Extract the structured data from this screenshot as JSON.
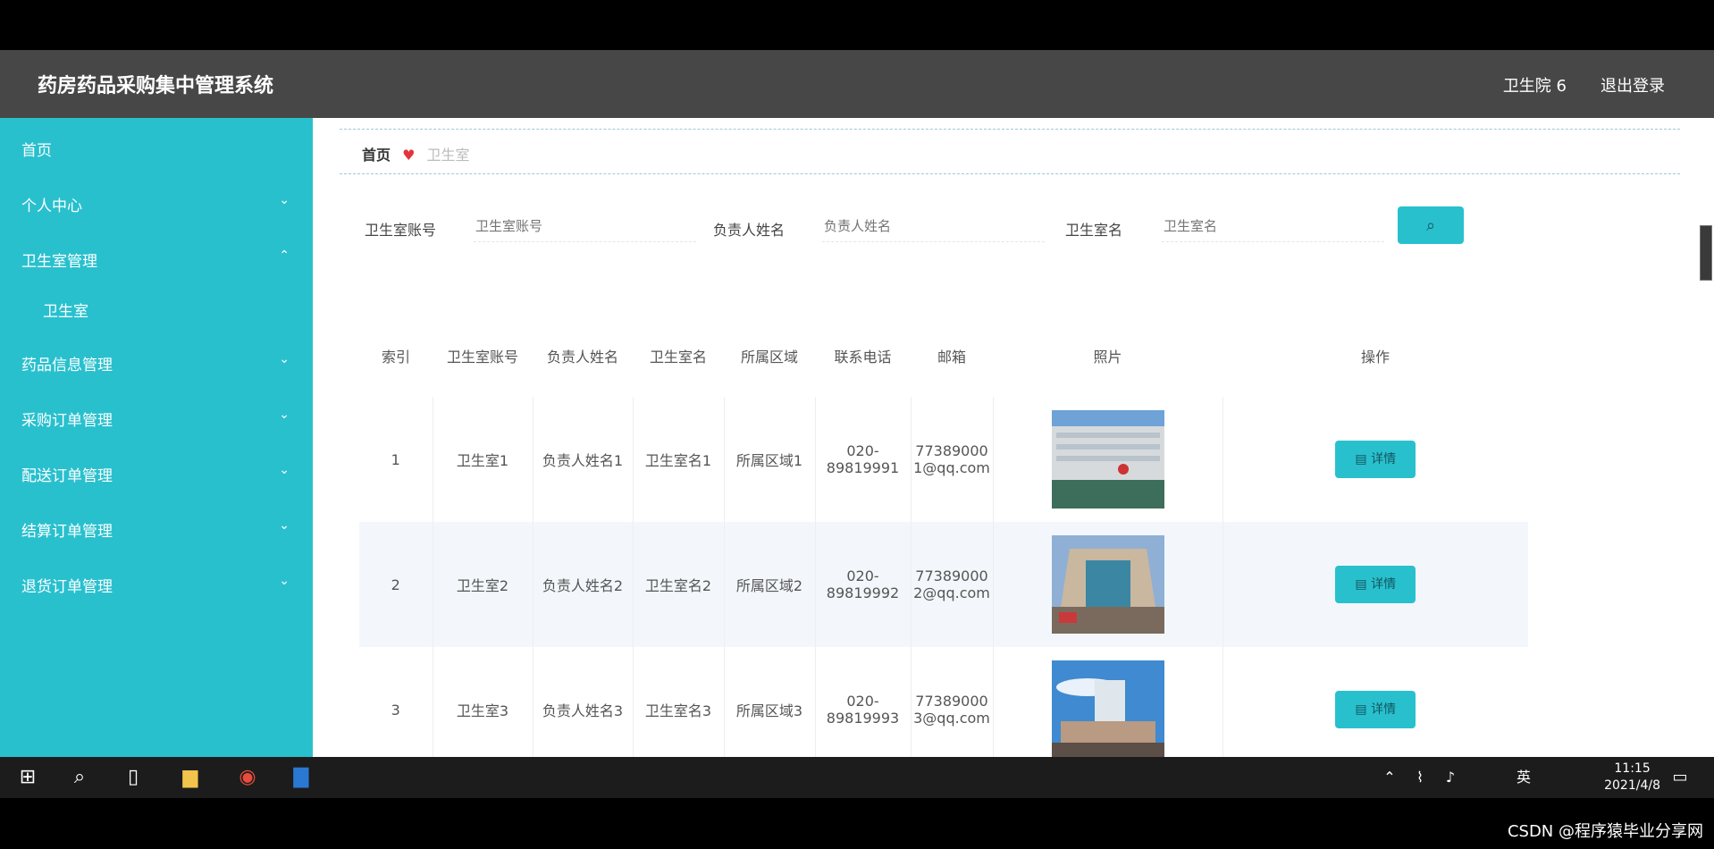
{
  "header": {
    "title": "药房药品采购集中管理系统",
    "user": "卫生院 6",
    "logout": "退出登录"
  },
  "sidebar": {
    "items": [
      {
        "label": "首页",
        "caret": ""
      },
      {
        "label": "个人中心",
        "caret": "⌄"
      },
      {
        "label": "卫生室管理",
        "caret": "⌃"
      },
      {
        "label": "卫生室",
        "caret": ""
      },
      {
        "label": "药品信息管理",
        "caret": "⌄"
      },
      {
        "label": "采购订单管理",
        "caret": "⌄"
      },
      {
        "label": "配送订单管理",
        "caret": "⌄"
      },
      {
        "label": "结算订单管理",
        "caret": "⌄"
      },
      {
        "label": "退货订单管理",
        "caret": "⌄"
      }
    ]
  },
  "breadcrumb": {
    "home": "首页",
    "current": "卫生室"
  },
  "search": {
    "label1": "卫生室账号",
    "ph1": "卫生室账号",
    "label2": "负责人姓名",
    "ph2": "负责人姓名",
    "label3": "卫生室名",
    "ph3": "卫生室名",
    "button_icon": "search-icon"
  },
  "table": {
    "headers": [
      "索引",
      "卫生室账号",
      "负责人姓名",
      "卫生室名",
      "所属区域",
      "联系电话",
      "邮箱",
      "照片",
      "操作"
    ],
    "rows": [
      {
        "idx": "1",
        "account": "卫生室1",
        "person": "负责人姓名1",
        "name": "卫生室名1",
        "area": "所属区域1",
        "phone": "020-89819991",
        "email": "773890001@qq.com",
        "action": "详情"
      },
      {
        "idx": "2",
        "account": "卫生室2",
        "person": "负责人姓名2",
        "name": "卫生室名2",
        "area": "所属区域2",
        "phone": "020-89819992",
        "email": "773890002@qq.com",
        "action": "详情"
      },
      {
        "idx": "3",
        "account": "卫生室3",
        "person": "负责人姓名3",
        "name": "卫生室名3",
        "area": "所属区域3",
        "phone": "020-89819993",
        "email": "773890003@qq.com",
        "action": "详情"
      }
    ]
  },
  "taskbar": {
    "ime": "英",
    "time": "11:15",
    "date": "2021/4/8"
  },
  "watermark": "CSDN @程序猿毕业分享网",
  "colors": {
    "accent": "#29c0ce",
    "header": "#474747"
  }
}
